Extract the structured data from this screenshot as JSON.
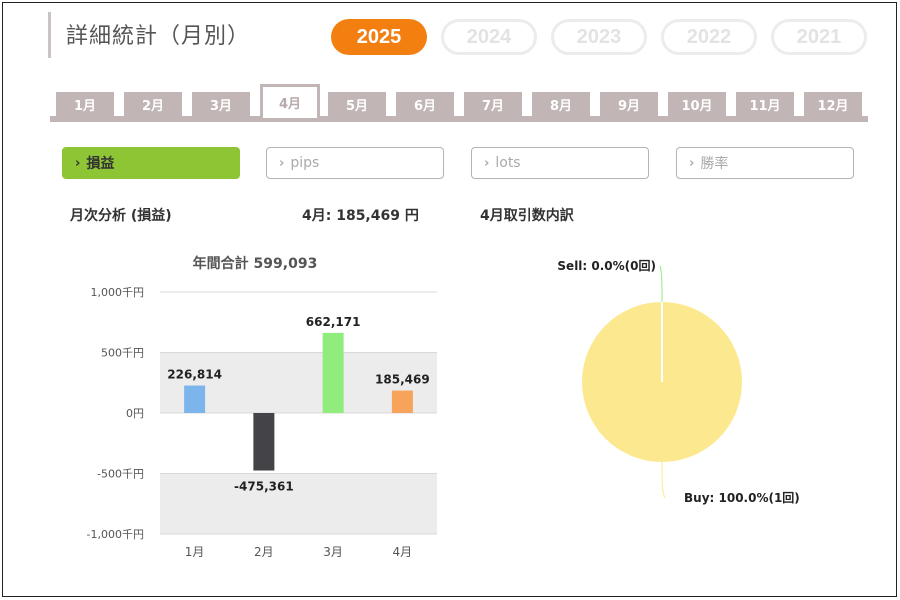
{
  "header": {
    "title": "詳細統計（月別）"
  },
  "years": [
    {
      "label": "2025",
      "active": true
    },
    {
      "label": "2024",
      "active": false
    },
    {
      "label": "2023",
      "active": false
    },
    {
      "label": "2022",
      "active": false
    },
    {
      "label": "2021",
      "active": false
    }
  ],
  "months": [
    "1月",
    "2月",
    "3月",
    "4月",
    "5月",
    "6月",
    "7月",
    "8月",
    "9月",
    "10月",
    "11月",
    "12月"
  ],
  "active_month": "4月",
  "metrics": [
    {
      "label": "損益",
      "active": true
    },
    {
      "label": "pips",
      "active": false
    },
    {
      "label": "lots",
      "active": false
    },
    {
      "label": "勝率",
      "active": false
    }
  ],
  "summary": {
    "section_title": "月次分析 (損益)",
    "month_value": "4月:  185,469 円",
    "trades_title": "4月取引数内訳"
  },
  "colors": {
    "accent": "#f47f11",
    "metric_active": "#8dc534",
    "tab": "#c2b5b5"
  },
  "chart_data": [
    {
      "type": "bar",
      "title": "年間合計 599,093",
      "categories": [
        "1月",
        "2月",
        "3月",
        "4月"
      ],
      "values": [
        226814,
        -475361,
        662171,
        185469
      ],
      "value_labels": [
        "226,814",
        "-475,361",
        "662,171",
        "185,469"
      ],
      "bar_colors": [
        "#7cb5ec",
        "#434348",
        "#90ed7d",
        "#f7a35c"
      ],
      "ylim": [
        -1000000,
        1000000
      ],
      "yticks": [
        1000000,
        500000,
        0,
        -500000,
        -1000000
      ],
      "ytick_labels": [
        "1,000千円",
        "500千円",
        "0円",
        "-500千円",
        "-1,000千円"
      ],
      "grid": true
    },
    {
      "type": "pie",
      "slices": [
        {
          "label": "Sell: 0.0%(0回)",
          "value": 0,
          "color": "#90ed7d"
        },
        {
          "label": "Buy: 100.0%(1回)",
          "value": 100,
          "color": "#fce98f"
        }
      ]
    }
  ]
}
